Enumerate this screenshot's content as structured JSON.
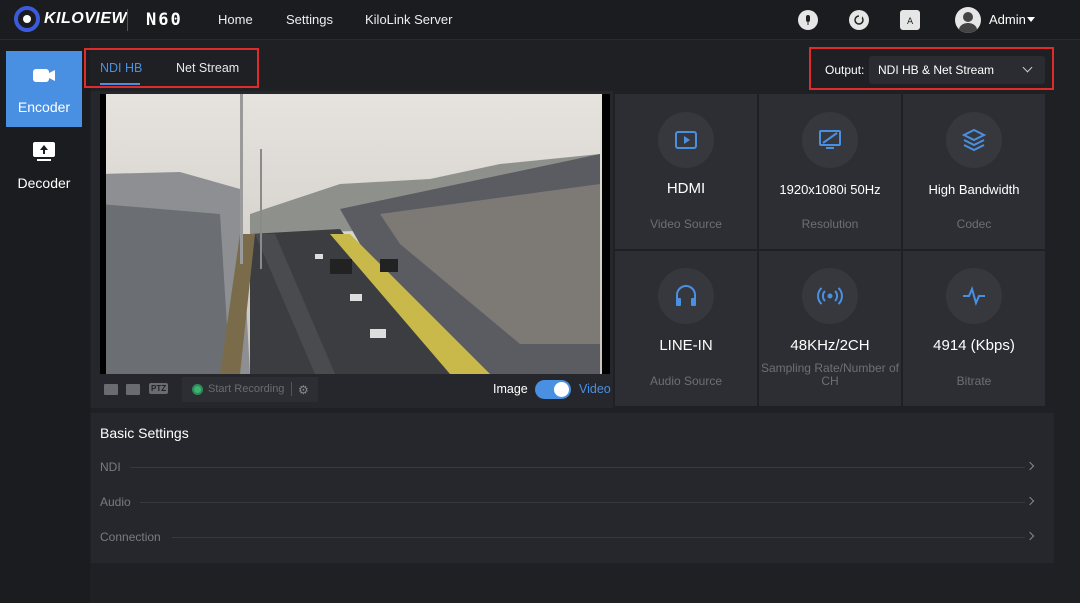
{
  "header": {
    "brand": "KILOVIEW",
    "model": "N60",
    "nav": [
      "Home",
      "Settings",
      "KiloLink Server"
    ],
    "user": "Admin",
    "icons": [
      "microphone-icon",
      "refresh-icon",
      "language-icon"
    ]
  },
  "sidebar": {
    "items": [
      {
        "label": "Encoder",
        "icon": "camera-icon",
        "active": true
      },
      {
        "label": "Decoder",
        "icon": "upload-monitor-icon",
        "active": false
      }
    ]
  },
  "tabs": [
    "NDI HB",
    "Net Stream"
  ],
  "output": {
    "label": "Output:",
    "value": "NDI HB & Net Stream"
  },
  "preview": {
    "controls": {
      "ptz": "PTZ",
      "recording": "Start Recording",
      "image_label": "Image",
      "video_label": "Video"
    }
  },
  "info": [
    {
      "value": "HDMI",
      "label": "Video Source",
      "icon": "play-icon"
    },
    {
      "value": "1920x1080i 50Hz",
      "label": "Resolution",
      "icon": "monitor-slash-icon"
    },
    {
      "value": "High Bandwidth",
      "label": "Codec",
      "icon": "layers-icon"
    },
    {
      "value": "LINE-IN",
      "label": "Audio Source",
      "icon": "headphones-icon"
    },
    {
      "value": "48KHz/2CH",
      "label": "Sampling Rate/Number of CH",
      "icon": "broadcast-icon"
    },
    {
      "value": "4914 (Kbps)",
      "label": "Bitrate",
      "icon": "pulse-icon"
    }
  ],
  "settings": {
    "title": "Basic Settings",
    "rows": [
      "NDI",
      "Audio",
      "Connection"
    ]
  },
  "colors": {
    "accent": "#4a90e2",
    "highlight_box": "#e02b2b"
  }
}
